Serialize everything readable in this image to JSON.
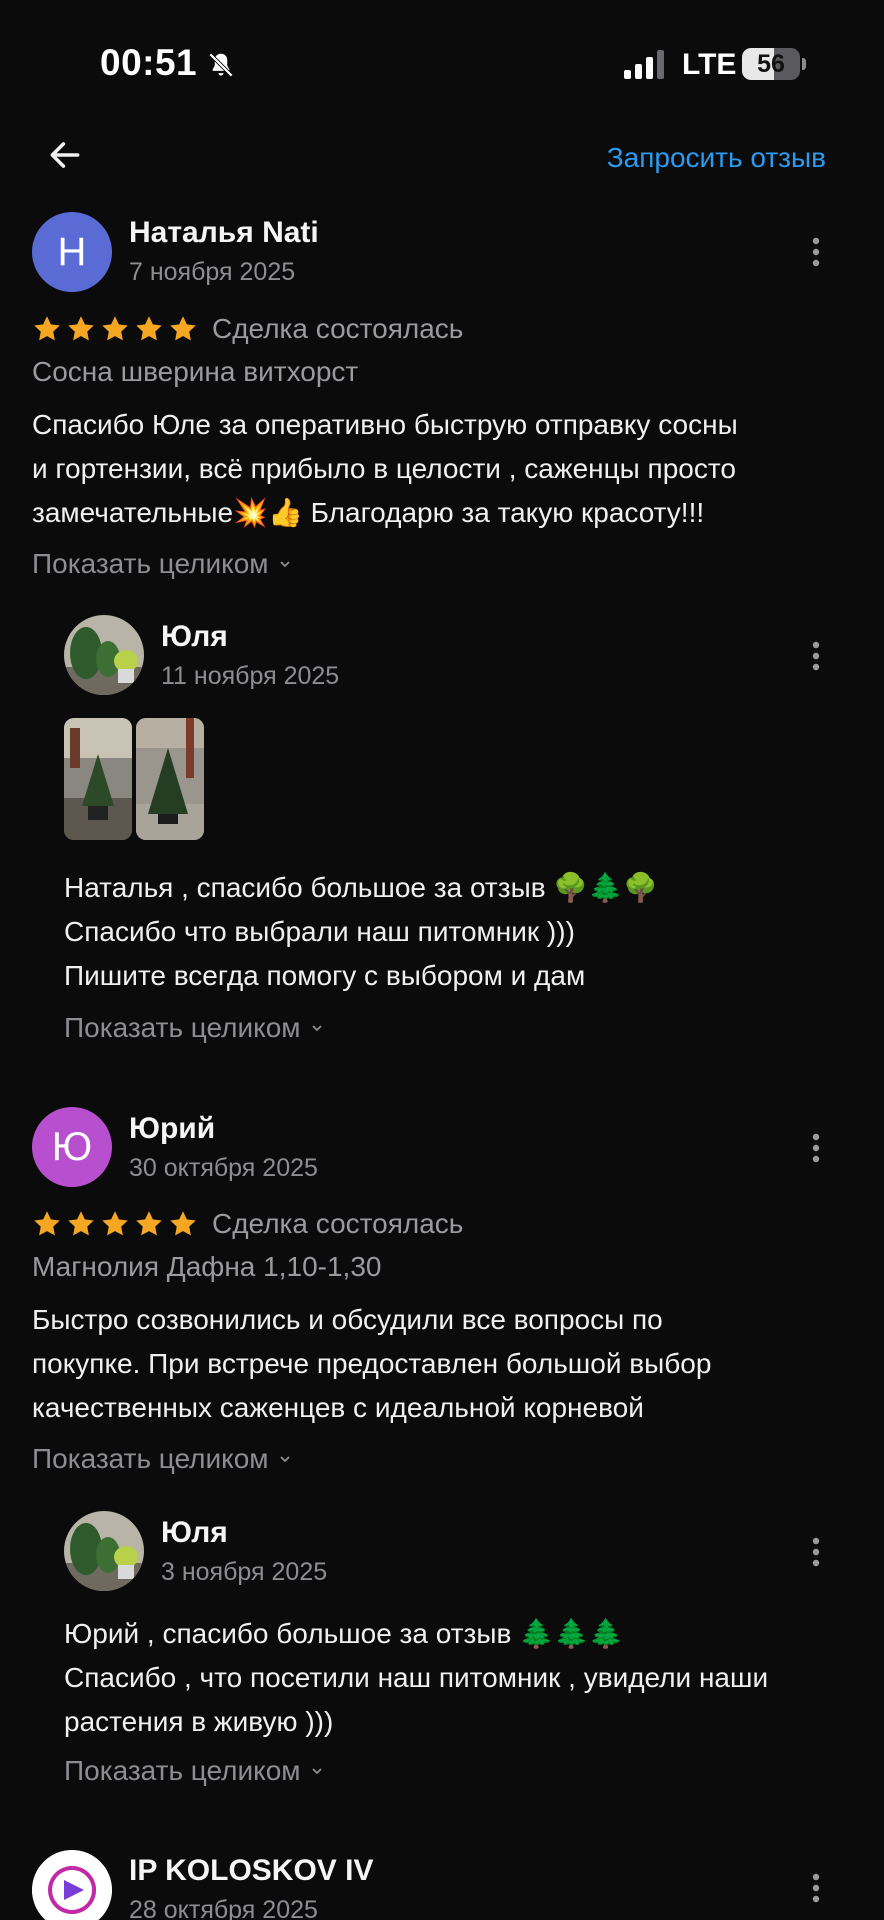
{
  "status_bar": {
    "time": "00:51",
    "network": "LTE",
    "battery": "56",
    "battery_level_percent": 56,
    "icons": [
      "bell-off-icon",
      "signal-icon",
      "battery-icon"
    ]
  },
  "header": {
    "back_icon": "arrow-left-icon",
    "request_review_label": "Запросить отзыв"
  },
  "reviews": [
    {
      "avatar_letter": "Н",
      "avatar_color": "#5b6bd6",
      "author": "Наталья Nati",
      "date": "7 ноября 2025",
      "rating": 5,
      "deal_status": "Сделка состоялась",
      "item": "Сосна шверина витхорст",
      "text": "Спасибо Юле за  оперативно быструю отправку  сосны\nи гортензии, всё прибыло в целости , саженцы просто\nзамечательные💥👍 Благодарю за такую красоту!!!",
      "show_more": "Показать целиком",
      "reply": {
        "author": "Юля",
        "date": "11 ноября 2025",
        "text": "Наталья , спасибо большое за отзыв 🌳🌲🌳\nСпасибо что выбрали наш питомник )))\nПишите всегда помогу с выбором и дам",
        "show_more": "Показать целиком",
        "photos": 2
      }
    },
    {
      "avatar_letter": "Ю",
      "avatar_color": "#b84fcf",
      "author": "Юрий",
      "date": "30 октября 2025",
      "rating": 5,
      "deal_status": "Сделка состоялась",
      "item": "Магнолия Дафна 1,10-1,30",
      "text": "Быстро созвонились и обсудили все вопросы по\nпокупке. При встрече предоставлен большой выбор\nкачественных саженцев с идеальной корневой",
      "show_more": "Показать целиком",
      "reply": {
        "author": "Юля",
        "date": "3 ноября 2025",
        "text": "Юрий , спасибо большое за отзыв 🌲🌲🌲\nСпасибо , что посетили наш питомник , увидели наши\nрастения в живую )))",
        "show_more": "Показать целиком"
      }
    },
    {
      "author": "IP KOLOSKOV IV",
      "date": "28 октября 2025"
    }
  ],
  "colors": {
    "background": "#0b0b0c",
    "accent": "#2a9bf0",
    "star": "#f5a623",
    "muted": "#8d8d92"
  }
}
